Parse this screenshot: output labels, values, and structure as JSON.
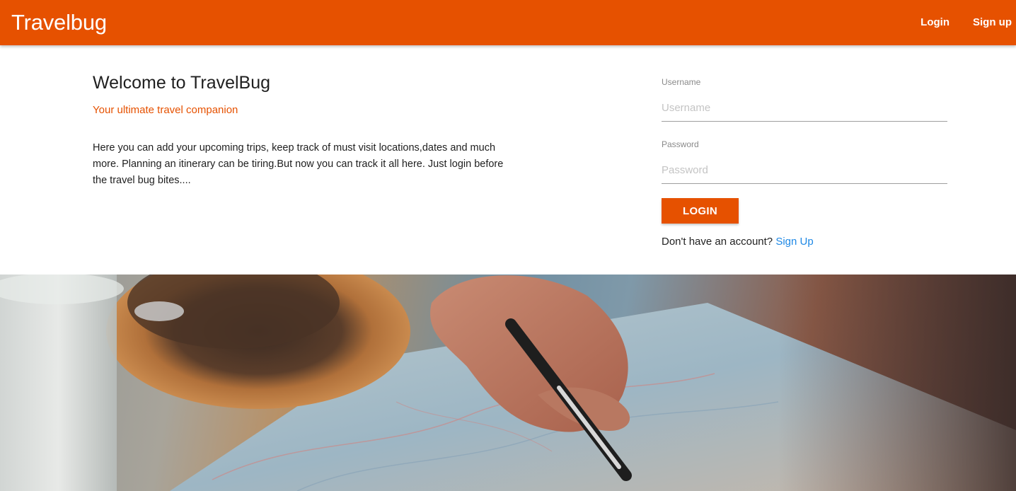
{
  "navbar": {
    "brand": "Travelbug",
    "links": [
      {
        "label": "Login"
      },
      {
        "label": "Sign up"
      }
    ]
  },
  "intro": {
    "heading": "Welcome to TravelBug",
    "tagline": "Your ultimate travel companion",
    "description": "Here you can add your upcoming trips, keep track of must visit locations,dates and much more. Planning an itinerary can be tiring.But now you can track it all here. Just login before the travel bug bites...."
  },
  "login_form": {
    "username": {
      "label": "Username",
      "placeholder": "Username",
      "value": ""
    },
    "password": {
      "label": "Password",
      "placeholder": "Password",
      "value": ""
    },
    "submit_label": "LOGIN",
    "signup_prompt": "Don't have an account?",
    "signup_link": "Sign Up"
  },
  "colors": {
    "brand_orange": "#e65100",
    "link_blue": "#1e88e5"
  }
}
